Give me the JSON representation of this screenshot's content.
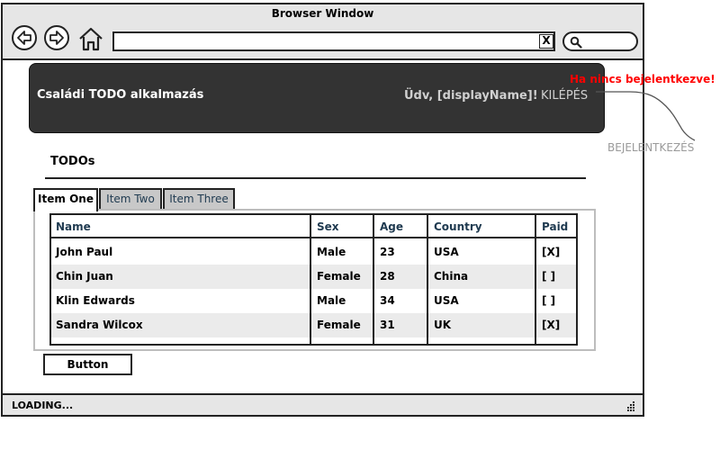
{
  "window": {
    "title": "Browser Window",
    "url_clear": "X",
    "status": "LOADING..."
  },
  "header": {
    "app_title": "Családi TODO alkalmazás",
    "welcome": "Üdv, [displayName]!",
    "logout": "KILÉPÉS"
  },
  "annotations": {
    "not_logged_in": "Ha nincs bejelentkezve!",
    "login": "BEJELENTKEZÉS"
  },
  "section": {
    "title": "TODOs"
  },
  "tabs": [
    {
      "label": "Item One",
      "active": true
    },
    {
      "label": "Item Two",
      "active": false
    },
    {
      "label": "Item Three",
      "active": false
    }
  ],
  "table": {
    "columns": [
      "Name",
      "Sex",
      "Age",
      "Country",
      "Paid"
    ],
    "rows": [
      [
        "John Paul",
        "Male",
        "23",
        "USA",
        "[X]"
      ],
      [
        "Chin Juan",
        "Female",
        "28",
        "China",
        "[ ]"
      ],
      [
        "Klin Edwards",
        "Male",
        "34",
        "USA",
        "[ ]"
      ],
      [
        "Sandra Wilcox",
        "Female",
        "31",
        "UK",
        "[X]"
      ]
    ]
  },
  "button": {
    "label": "Button"
  },
  "icons": {
    "back": "back-arrow-icon",
    "forward": "forward-arrow-icon",
    "home": "home-icon",
    "search": "search-icon",
    "grip": "resize-grip-icon"
  },
  "colors": {
    "header_bg": "#333333",
    "annotation_red": "#ff0000",
    "annotation_gray": "#9a9a9a",
    "inactive_tab": "#c8c8c8"
  }
}
